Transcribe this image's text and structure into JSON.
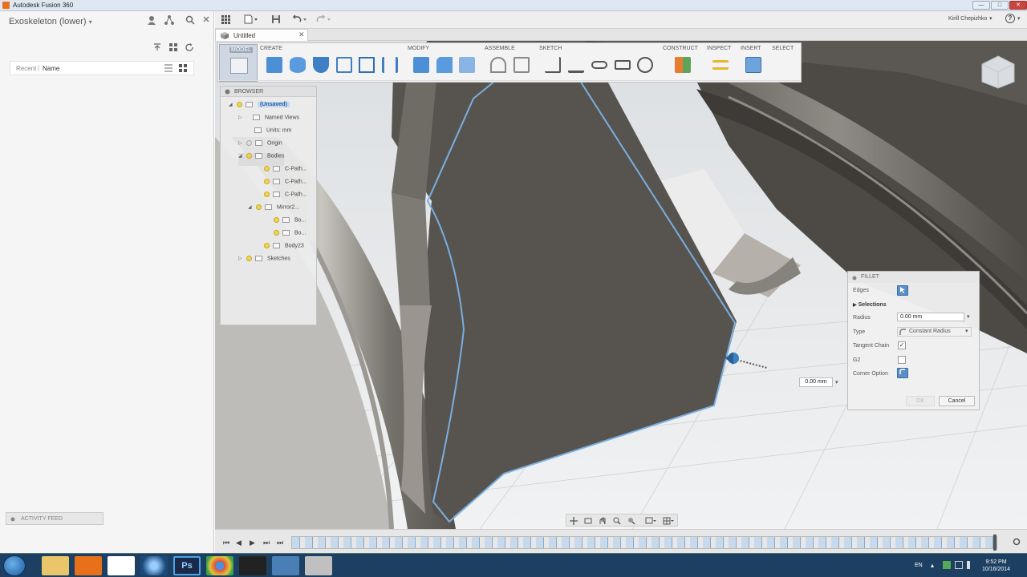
{
  "window": {
    "title": "Autodesk Fusion 360",
    "min": "—",
    "max": "□",
    "close": "✕"
  },
  "data_panel": {
    "project_title": "Exoskeleton (lower)",
    "dropdown_glyph": "▾",
    "recent_label": "Recent",
    "name_label": "Name",
    "activity_feed": "ACTIVITY FEED"
  },
  "header": {
    "user_name": "Kirill Chepizhko",
    "help_glyph": "?"
  },
  "document_tab": {
    "label": "Untitled",
    "close": "✕"
  },
  "toolbar": {
    "model": "MODEL",
    "groups": {
      "create": "CREATE",
      "modify": "MODIFY",
      "assemble": "ASSEMBLE",
      "sketch": "SKETCH",
      "construct": "CONSTRUCT",
      "inspect": "INSPECT",
      "insert": "INSERT",
      "select": "SELECT"
    }
  },
  "browser": {
    "title": "BROWSER",
    "items": [
      {
        "label": "(Unsaved)"
      },
      {
        "label": "Named Views"
      },
      {
        "label": "Units: mm"
      },
      {
        "label": "Origin"
      },
      {
        "label": "Bodies"
      },
      {
        "label": "C-Path..."
      },
      {
        "label": "C-Path..."
      },
      {
        "label": "C-Path..."
      },
      {
        "label": "Mirror2..."
      },
      {
        "label": "Bo..."
      },
      {
        "label": "Bo..."
      },
      {
        "label": "Body23"
      },
      {
        "label": "Sketches"
      }
    ]
  },
  "fillet": {
    "title": "FILLET",
    "edges_label": "Edges",
    "selections_label": "Selections",
    "radius_label": "Radius",
    "radius_value": "0.00 mm",
    "type_label": "Type",
    "type_value": "Constant Radius",
    "tangent_chain_label": "Tangent Chain",
    "tangent_chain_checked": true,
    "g2_label": "G2",
    "g2_checked": false,
    "corner_option_label": "Corner Option",
    "ok_label": "OK",
    "cancel_label": "Cancel"
  },
  "floating_input": {
    "value": "0.00 mm"
  },
  "taskbar": {
    "language": "EN",
    "time": "9:52 PM",
    "date": "10/16/2014",
    "ps_label": "Ps"
  },
  "colors": {
    "accent_blue": "#5b8ec4",
    "selection_edge": "#7aaee0",
    "taskbar": "#1c3f62"
  }
}
